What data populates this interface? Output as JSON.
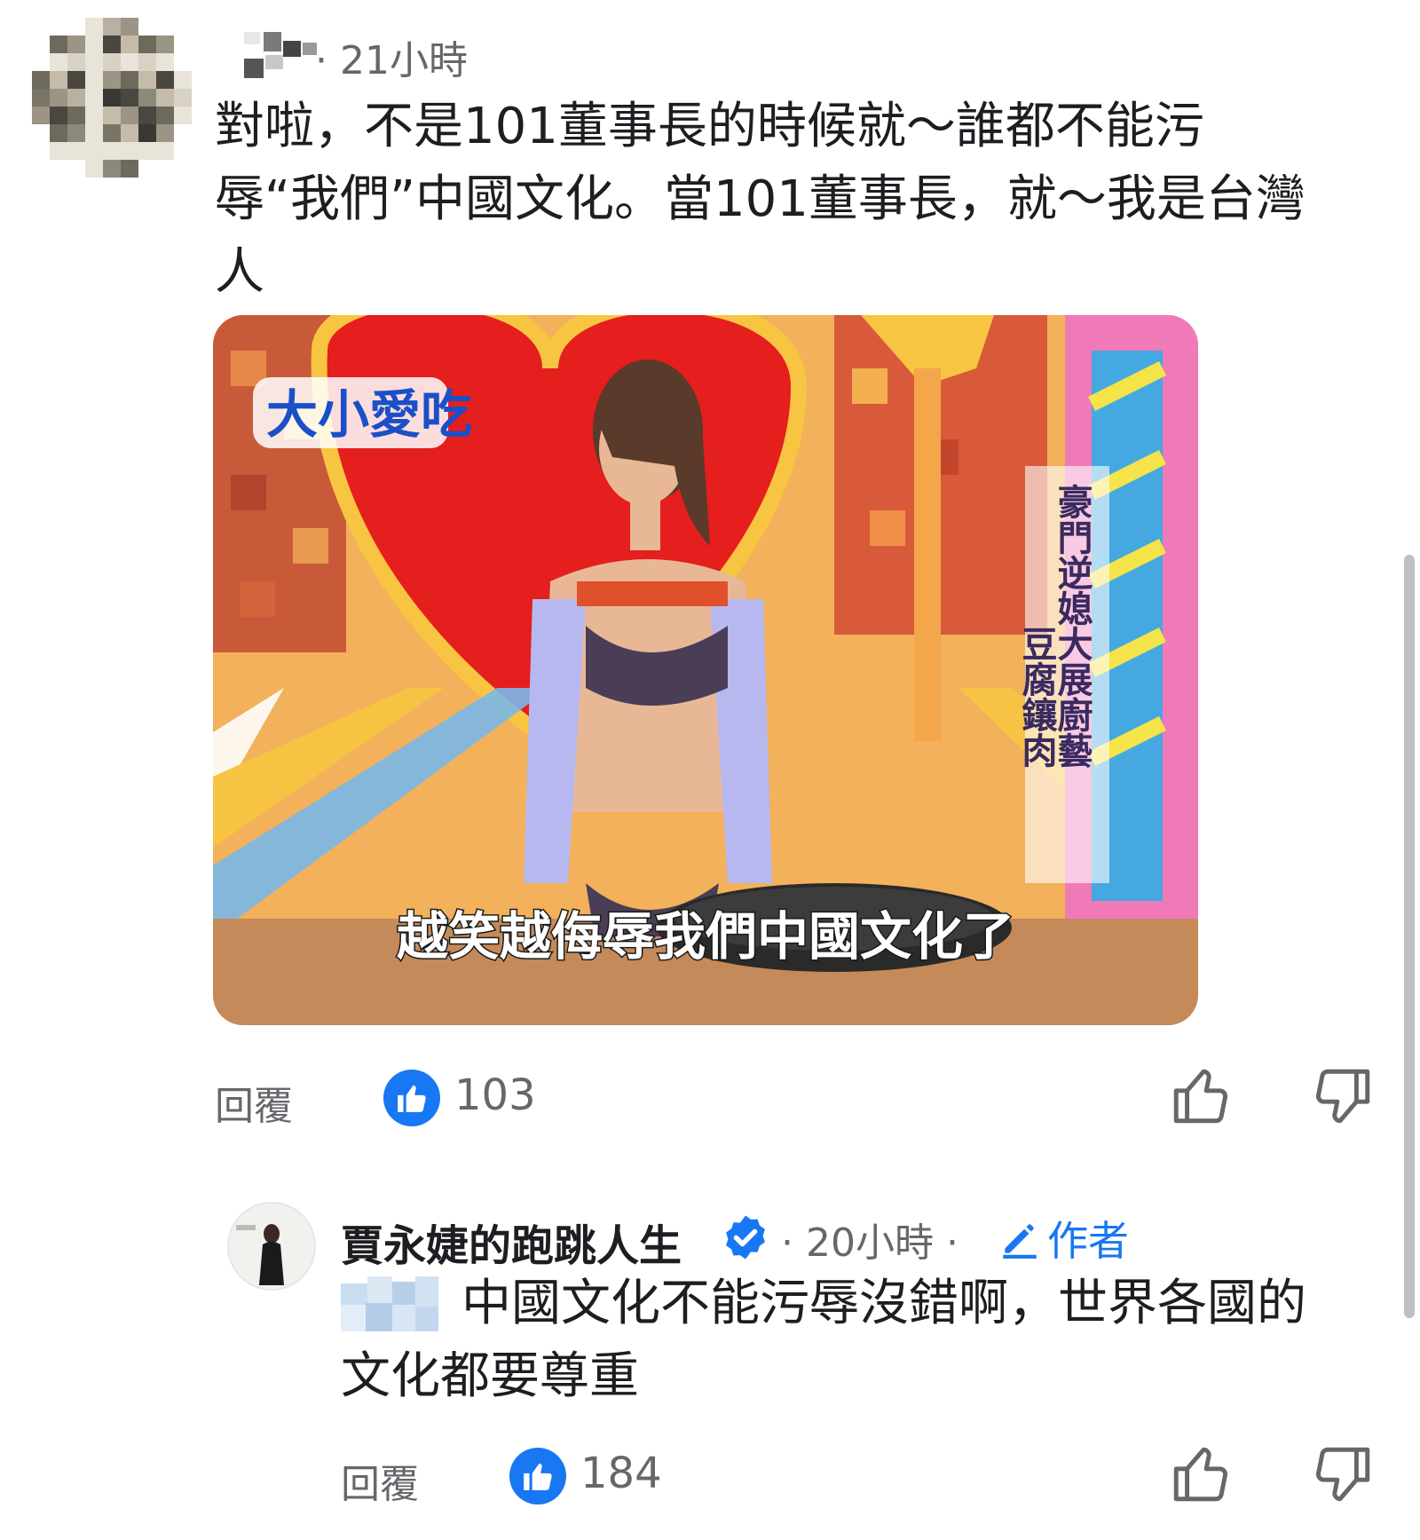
{
  "comment": {
    "time": "· 21小時",
    "text_lines": [
      "對啦，不是101董事長的時候就～誰都不能污",
      "辱“我們”中國文化。當101董事長，就～我是台灣",
      "人"
    ],
    "media": {
      "show_logo": "大小愛吃",
      "side_caption_main": "豪門逆媳大展廚藝",
      "side_caption_sub": "豆腐鑲肉",
      "subtitle": "越笑越侮辱我們中國文化了"
    },
    "reply_label": "回覆",
    "like_count": "103"
  },
  "reply": {
    "author_name": "賈永婕的跑跳人生",
    "time": "· 20小時 ·",
    "author_badge": "作者",
    "text_lines": [
      "中國文化不能污辱沒錯啊，世界各國的",
      "文化都要尊重"
    ],
    "reply_label": "回覆",
    "like_count": "184"
  },
  "icons": {
    "like_badge": "thumbs-up-icon",
    "upvote": "thumb-up-outline-icon",
    "downvote": "thumb-down-outline-icon",
    "verified": "verified-badge-icon",
    "author": "pencil-icon"
  },
  "colors": {
    "accent": "#1877f2",
    "secondary_text": "#65676b",
    "primary_text": "#1c1e21"
  }
}
